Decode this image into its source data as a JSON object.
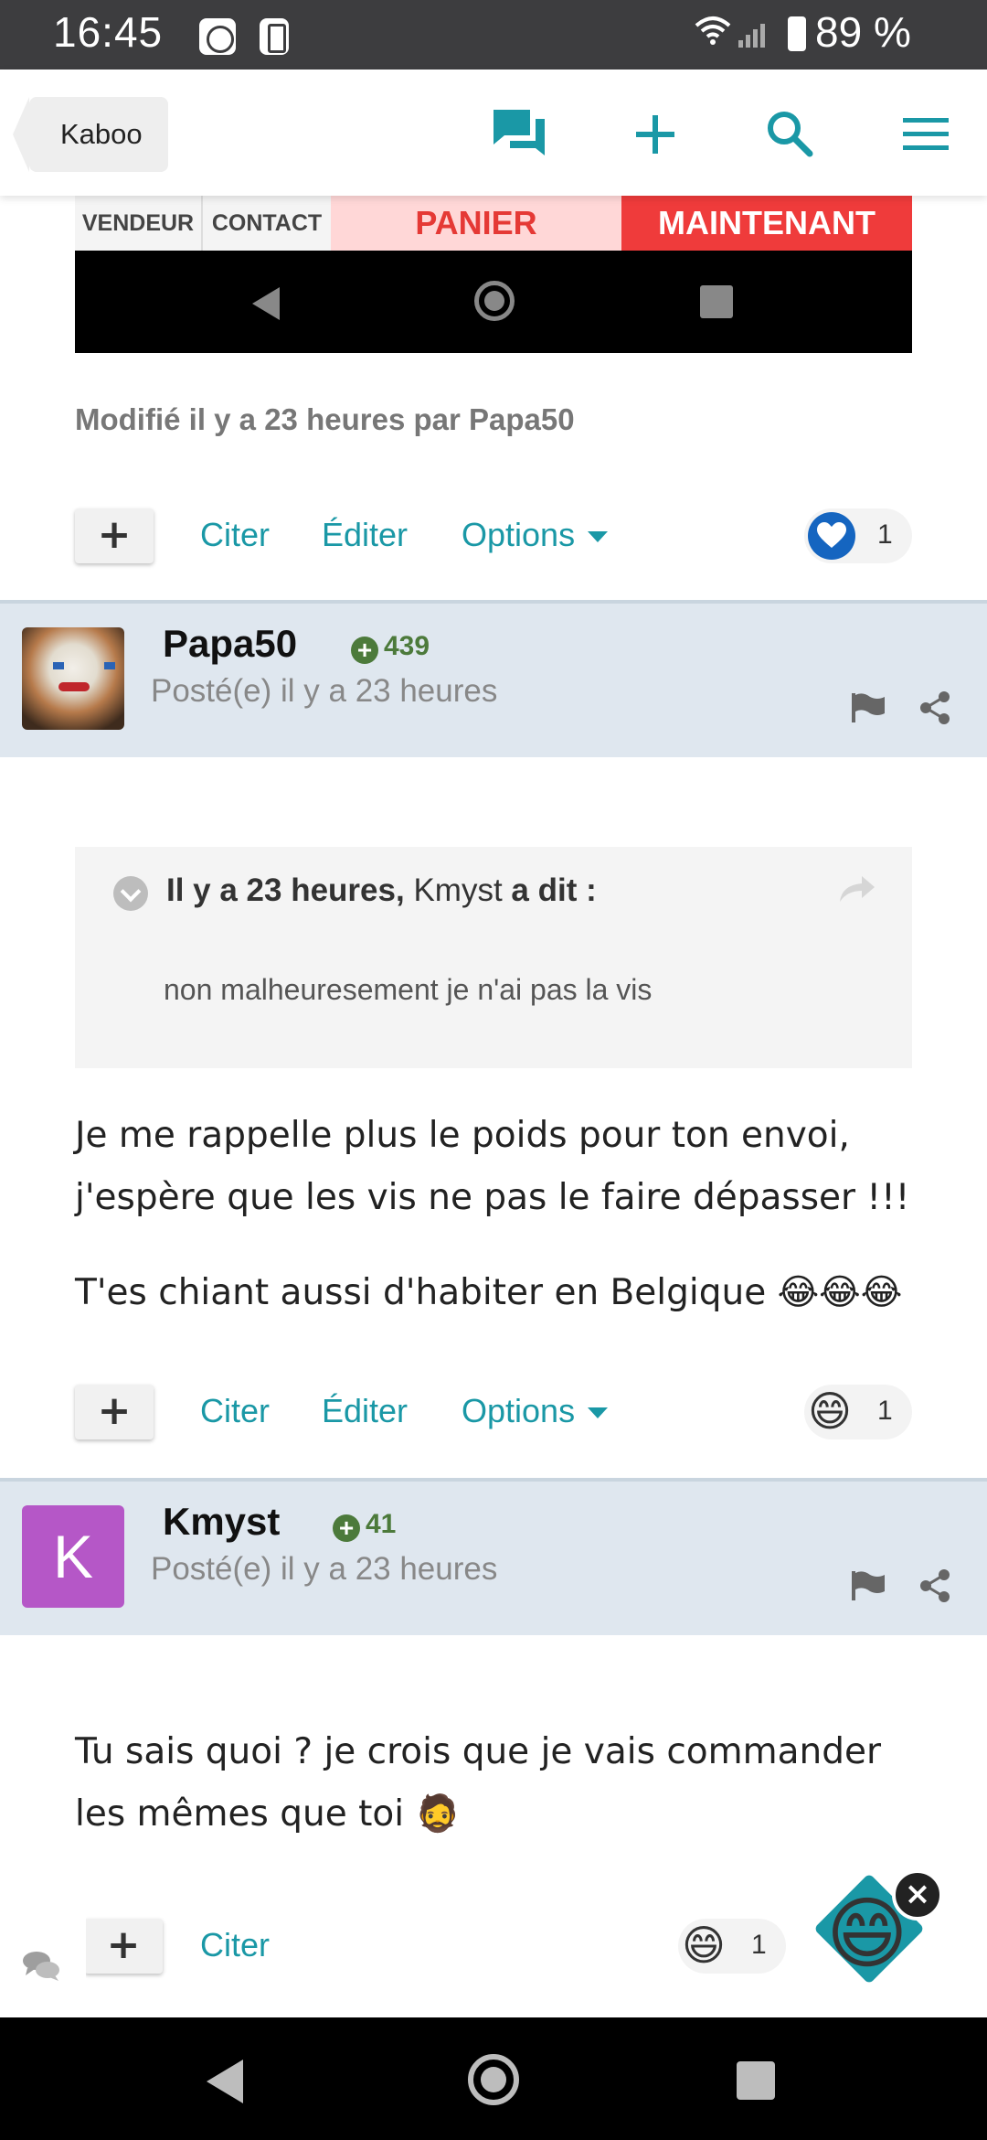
{
  "status_bar": {
    "time": "16:45",
    "battery": "89 %"
  },
  "header": {
    "back_label": "Kaboo"
  },
  "embedded_screenshot": {
    "labels": [
      "VENDEUR",
      "CONTACT",
      "PANIER",
      "MAINTENANT"
    ]
  },
  "post1": {
    "modified": "Modifié il y a 23 heures par Papa50",
    "actions": {
      "quote": "Citer",
      "edit": "Éditer",
      "options": "Options"
    },
    "reaction_count": "1",
    "reaction_icon": "heart-icon"
  },
  "post2": {
    "author": "Papa50",
    "reputation": "439",
    "posted": "Posté(e) il y a 23 heures",
    "quote": {
      "time": "Il y a 23 heures,",
      "author": "Kmyst",
      "said": "a dit :",
      "body": "non malheuresement je n'ai pas la vis"
    },
    "lines": [
      "Je me rappelle plus le poids pour ton envoi,",
      "j'espère que les vis ne pas le faire dépasser !!!"
    ],
    "line3": "T'es chiant aussi d'habiter en Belgique 😂😂😂",
    "actions": {
      "quote": "Citer",
      "edit": "Éditer",
      "options": "Options"
    },
    "reaction_count": "1",
    "reaction_emoji": "😄"
  },
  "post3": {
    "author": "Kmyst",
    "avatar_letter": "K",
    "reputation": "41",
    "posted": "Posté(e) il y a 23 heures",
    "lines": [
      "Tu sais quoi ? je crois que je vais commander",
      "les mêmes que toi 🧔"
    ],
    "actions": {
      "quote": "Citer"
    },
    "reaction_count": "1",
    "reaction_emoji": "😄"
  },
  "overlay": {
    "close": "×",
    "emoji": "😄"
  },
  "colors": {
    "accent": "#1a98a6",
    "author_bar": "#dfe7ef",
    "rep_green": "#4c7a3b"
  }
}
